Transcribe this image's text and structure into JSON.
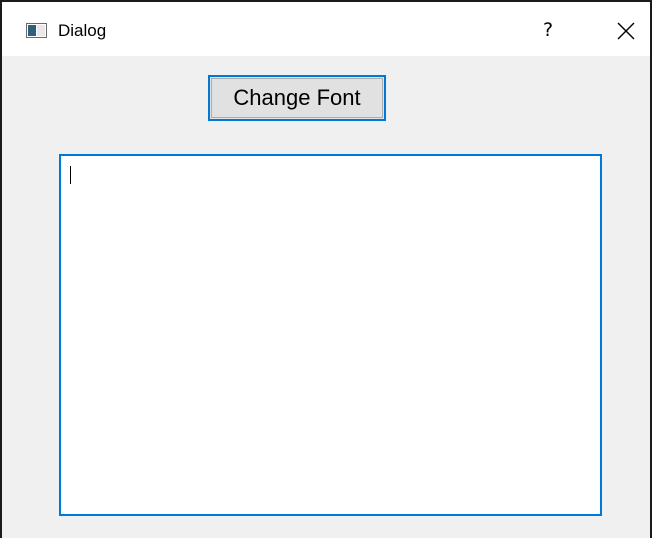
{
  "window": {
    "title": "Dialog",
    "help_label": "?",
    "icons": {
      "app": "app-window-icon",
      "close": "close-icon"
    }
  },
  "main": {
    "change_font_button_label": "Change Font",
    "text_edit_value": ""
  },
  "colors": {
    "focus_accent": "#0078d7",
    "dialog_background": "#f0f0f0",
    "button_background": "#e1e1e1"
  }
}
